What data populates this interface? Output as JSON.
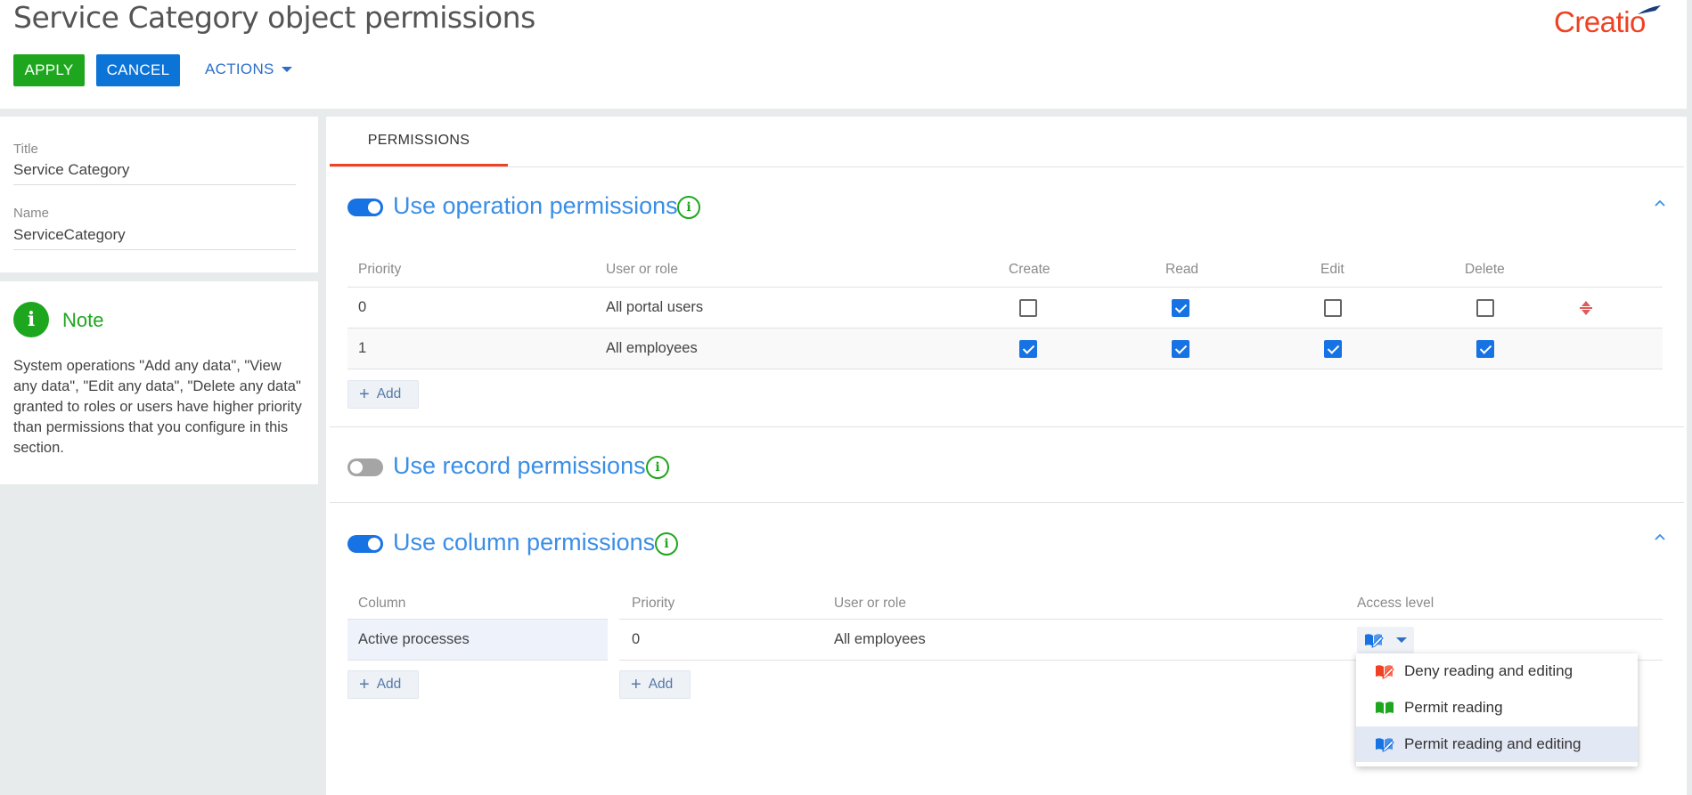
{
  "header": {
    "title": "Service Category object permissions",
    "apply_label": "APPLY",
    "cancel_label": "CANCEL",
    "actions_label": "ACTIONS",
    "logo_text": "Creatio"
  },
  "info_card": {
    "title_caption": "Title",
    "title_value": "Service Category",
    "name_caption": "Name",
    "name_value": "ServiceCategory"
  },
  "note": {
    "title": "Note",
    "text": "System operations \"Add any data\", \"View any data\", \"Edit any data\", \"Delete any data\" granted to roles or users have higher priority than permissions that you configure in this section."
  },
  "tabs": [
    {
      "label": "PERMISSIONS",
      "active": true
    }
  ],
  "operation_permissions": {
    "title": "Use operation permissions",
    "enabled": true,
    "columns": {
      "priority": "Priority",
      "user": "User or role",
      "create": "Create",
      "read": "Read",
      "edit": "Edit",
      "delete": "Delete"
    },
    "rows": [
      {
        "priority": "0",
        "user": "All portal users",
        "create": false,
        "read": true,
        "edit": false,
        "delete": false
      },
      {
        "priority": "1",
        "user": "All employees",
        "create": true,
        "read": true,
        "edit": true,
        "delete": true
      }
    ],
    "add_label": "Add"
  },
  "record_permissions": {
    "title": "Use record permissions",
    "enabled": false
  },
  "column_permissions": {
    "title": "Use column permissions",
    "enabled": true,
    "columns": {
      "column": "Column",
      "priority": "Priority",
      "user": "User or role",
      "access": "Access level"
    },
    "rows": [
      {
        "column": "Active processes",
        "priority": "0",
        "user": "All employees"
      }
    ],
    "add_column_label": "Add",
    "add_priority_label": "Add"
  },
  "access_dropdown": {
    "options": [
      {
        "label": "Deny reading and editing",
        "icon": "deny-read-edit-icon",
        "color": "#ef4123"
      },
      {
        "label": "Permit reading",
        "icon": "permit-read-icon",
        "color": "#1ea71e"
      },
      {
        "label": "Permit reading and editing",
        "icon": "permit-read-edit-icon",
        "color": "#1773e3"
      }
    ],
    "selected_index": 2
  },
  "colors": {
    "accent_blue": "#1773e3",
    "apply_green": "#1ea71e",
    "cancel_blue": "#0d74d7",
    "tab_underline": "#ef4123",
    "section_title": "#3a8ee6"
  }
}
